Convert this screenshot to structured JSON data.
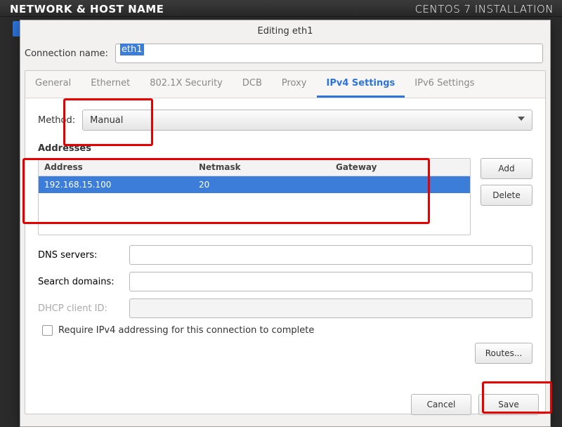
{
  "header": {
    "bg_left": "NETWORK & HOST NAME",
    "bg_right": "CENTOS 7 INSTALLATION"
  },
  "dialog": {
    "title": "Editing eth1",
    "conn_name_label": "Connection name:",
    "conn_name_value": "eth1",
    "tabs": {
      "general": "General",
      "ethernet": "Ethernet",
      "security": "802.1X Security",
      "dcb": "DCB",
      "proxy": "Proxy",
      "ipv4": "IPv4 Settings",
      "ipv6": "IPv6 Settings"
    },
    "ipv4": {
      "method_label": "Method:",
      "method_value": "Manual",
      "addresses_title": "Addresses",
      "columns": {
        "address": "Address",
        "netmask": "Netmask",
        "gateway": "Gateway"
      },
      "rows": [
        {
          "address": "192.168.15.100",
          "netmask": "20",
          "gateway": ""
        }
      ],
      "add_label": "Add",
      "delete_label": "Delete",
      "dns_label": "DNS servers:",
      "dns_value": "",
      "search_label": "Search domains:",
      "search_value": "",
      "dhcp_label": "DHCP client ID:",
      "dhcp_value": "",
      "require_label": "Require IPv4 addressing for this connection to complete",
      "routes_label": "Routes..."
    },
    "actions": {
      "cancel": "Cancel",
      "save": "Save"
    }
  }
}
